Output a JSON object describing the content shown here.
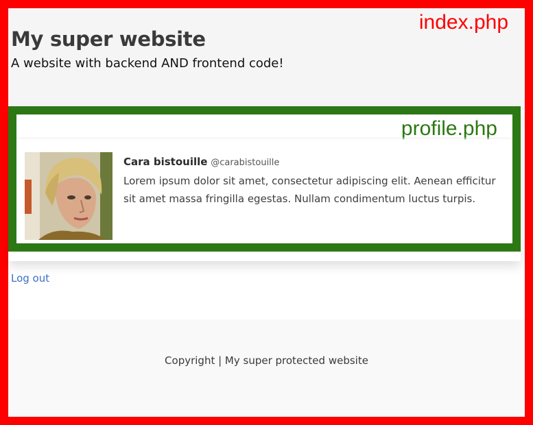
{
  "hero": {
    "file_label": "index.php",
    "title": "My super website",
    "subtitle": "A website with backend AND frontend code!"
  },
  "profile": {
    "file_label": "profile.php",
    "name": "Cara bistouille",
    "handle": "@carabistouille",
    "bio": "Lorem ipsum dolor sit amet, consectetur adipiscing elit. Aenean efficitur sit amet massa fringilla egestas. Nullam condimentum luctus turpis."
  },
  "links": {
    "logout": "Log out"
  },
  "footer": {
    "copyright": "Copyright | My super protected website"
  },
  "colors": {
    "frame": "#ff0000",
    "profile_border": "#2c7814",
    "link": "#3a6fc4"
  }
}
